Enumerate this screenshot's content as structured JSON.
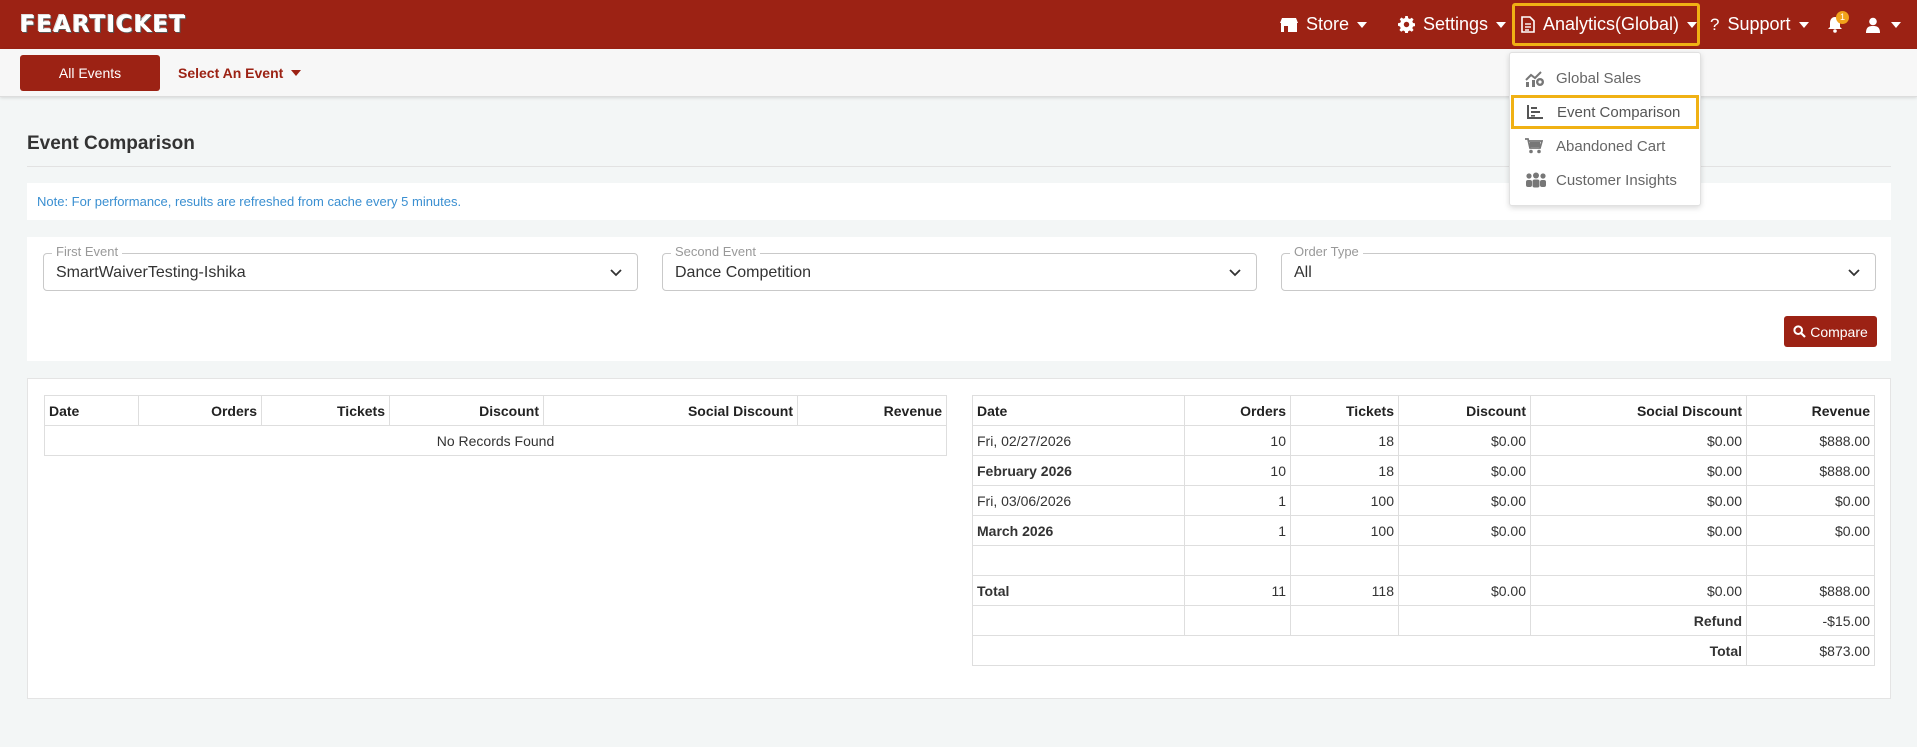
{
  "brand": {
    "logo_text": "FEARTICKET",
    "primary_color": "#9c2214",
    "highlight_color": "#f0b114"
  },
  "nav": {
    "store": "Store",
    "settings": "Settings",
    "analytics": "Analytics(Global)",
    "support": "Support",
    "notification_count": "1"
  },
  "subnav": {
    "all_events": "All Events",
    "select_event": "Select An Event"
  },
  "analytics_menu": {
    "items": [
      "Global Sales",
      "Event Comparison",
      "Abandoned Cart",
      "Customer Insights"
    ],
    "active_item": "Event Comparison"
  },
  "page": {
    "title": "Event Comparison",
    "note": "Note: For performance, results are refreshed from cache every 5 minutes."
  },
  "filters": {
    "first_event": {
      "label": "First Event",
      "value": "SmartWaiverTesting-Ishika"
    },
    "second_event": {
      "label": "Second Event",
      "value": "Dance Competition"
    },
    "order_type": {
      "label": "Order Type",
      "value": "All"
    },
    "compare_button": "Compare"
  },
  "table_columns": [
    "Date",
    "Orders",
    "Tickets",
    "Discount",
    "Social Discount",
    "Revenue"
  ],
  "first_table": {
    "empty_message": "No Records Found"
  },
  "second_table": {
    "rows": [
      {
        "date": "Fri, 02/27/2026",
        "orders": "10",
        "tickets": "18",
        "discount": "$0.00",
        "social": "$0.00",
        "revenue": "$888.00"
      },
      {
        "date": "February 2026",
        "orders": "10",
        "tickets": "18",
        "discount": "$0.00",
        "social": "$0.00",
        "revenue": "$888.00"
      },
      {
        "date": "Fri, 03/06/2026",
        "orders": "1",
        "tickets": "100",
        "discount": "$0.00",
        "social": "$0.00",
        "revenue": "$0.00"
      },
      {
        "date": "March 2026",
        "orders": "1",
        "tickets": "100",
        "discount": "$0.00",
        "social": "$0.00",
        "revenue": "$0.00"
      }
    ],
    "total": {
      "label": "Total",
      "orders": "11",
      "tickets": "118",
      "discount": "$0.00",
      "social": "$0.00",
      "revenue": "$888.00"
    },
    "refund": {
      "label": "Refund",
      "value": "-$15.00"
    },
    "grand_total": {
      "label": "Total",
      "value": "$873.00"
    }
  }
}
